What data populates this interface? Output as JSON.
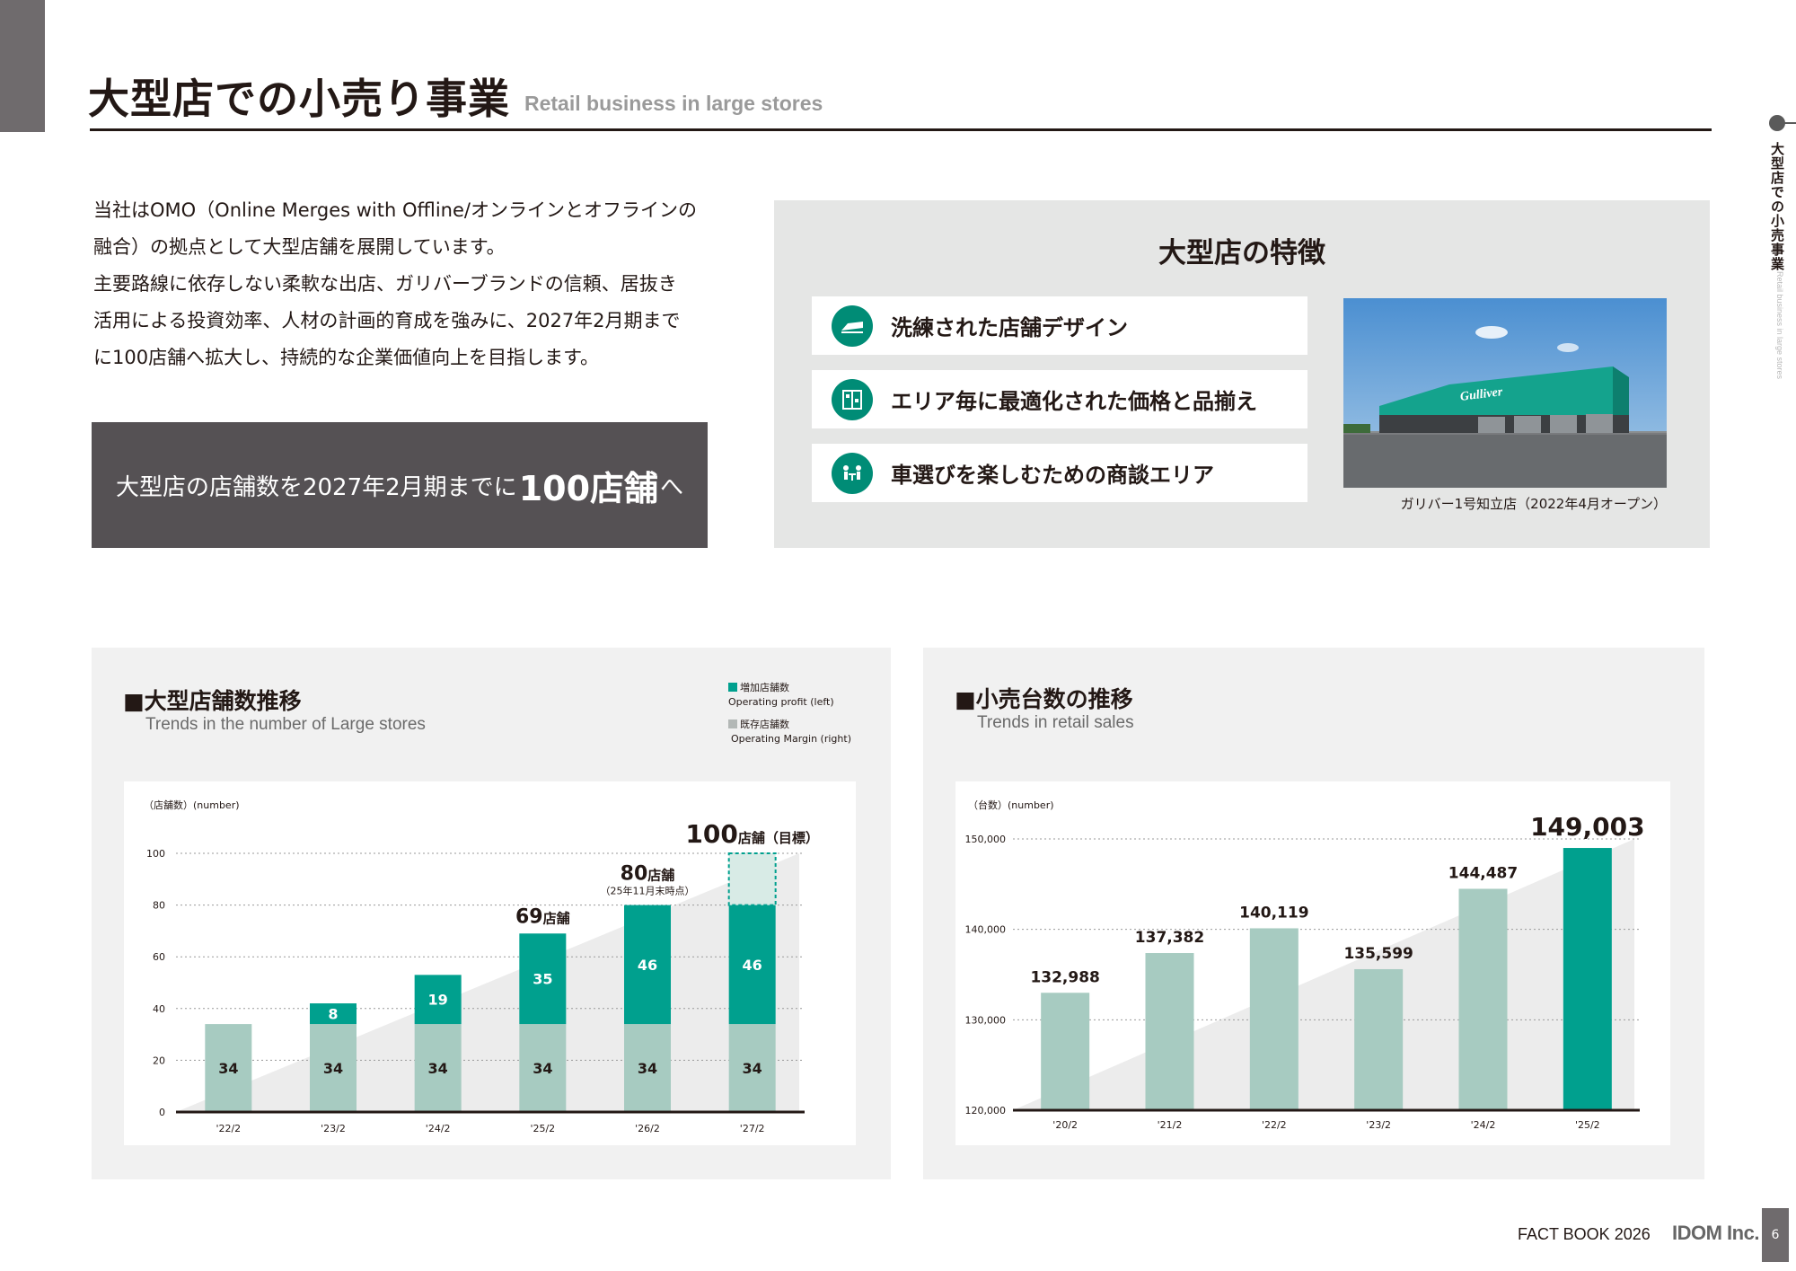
{
  "header": {
    "title_jp": "大型店での小売り事業",
    "title_en": "Retail business in large stores"
  },
  "side_label": {
    "jp": "大型店での小売事業",
    "en": "Retail business in large stores"
  },
  "intro": {
    "lines": [
      "当社はOMO（Online Merges with Offline/オンラインとオフラインの",
      "融合）の拠点として大型店舗を展開しています。",
      "主要路線に依存しない柔軟な出店、ガリバーブランドの信頼、居抜き",
      "活用による投資効率、人材の計画的育成を強みに、2027年2月期まで",
      "に100店舗へ拡大し、持続的な企業価値向上を目指します。"
    ]
  },
  "goal": {
    "prefix": "大型店の店舗数を2027年2月期までに",
    "highlight": "100店舗",
    "suffix": "へ"
  },
  "features": {
    "title": "大型店の特徴",
    "items": [
      {
        "label": "洗練された店舗デザイン",
        "icon": "store-design-icon"
      },
      {
        "label": "エリア毎に最適化された価格と品揃え",
        "icon": "price-lineup-icon"
      },
      {
        "label": "車選びを楽しむための商談エリア",
        "icon": "consultation-area-icon"
      }
    ],
    "photo_sign": "Gulliver",
    "photo_caption": "ガリバー1号知立店（2022年4月オープン）"
  },
  "colors": {
    "teal": "#00a08e",
    "light_teal": "#a7cbc1",
    "dark_panel": "#555154",
    "feature_icon": "#008c76"
  },
  "chart_data": [
    {
      "type": "bar",
      "stacked": true,
      "title": "■大型店舗数推移",
      "subtitle": "Trends in the number of Large stores",
      "unit_label": "（店舗数）(number)",
      "legend": [
        {
          "jp": "増加店舗数",
          "en": "Operating profit (left)",
          "color": "#00a08e"
        },
        {
          "jp": "既存店舗数",
          "en": "Operating Margin (right)",
          "color": "#b3b8b6"
        }
      ],
      "categories": [
        "'22/2",
        "'23/2",
        "'24/2",
        "'25/2",
        "'26/2",
        "'27/2"
      ],
      "series": [
        {
          "name": "既存店舗数",
          "values": [
            34,
            34,
            34,
            34,
            34,
            34
          ]
        },
        {
          "name": "増加店舗数",
          "values": [
            0,
            8,
            19,
            35,
            46,
            46
          ]
        }
      ],
      "target": {
        "category": "'27/2",
        "total": 100
      },
      "ylim": [
        0,
        100
      ],
      "yticks": [
        0,
        20,
        40,
        60,
        80,
        100
      ],
      "annotations": [
        {
          "category": "'25/2",
          "num": "69",
          "unit": "店舗",
          "note": ""
        },
        {
          "category": "'26/2",
          "num": "80",
          "unit": "店舗",
          "note": "（25年11月末時点）"
        },
        {
          "category": "'27/2",
          "num": "100",
          "unit": "店舗（目標）",
          "note": ""
        }
      ],
      "grid": true
    },
    {
      "type": "bar",
      "title": "■小売台数の推移",
      "subtitle": "Trends in retail sales",
      "unit_label": "（台数）(number)",
      "categories": [
        "'20/2",
        "'21/2",
        "'22/2",
        "'23/2",
        "'24/2",
        "'25/2"
      ],
      "values": [
        132988,
        137382,
        140119,
        135599,
        144487,
        149003
      ],
      "value_labels": [
        "132,988",
        "137,382",
        "140,119",
        "135,599",
        "144,487",
        "149,003"
      ],
      "ylim": [
        120000,
        150000
      ],
      "yticks": [
        120000,
        130000,
        140000,
        150000
      ],
      "ytick_labels": [
        "120,000",
        "130,000",
        "140,000",
        "150,000"
      ],
      "highlight_index": 5,
      "grid": true
    }
  ],
  "footer": {
    "factbook": "FACT BOOK 2026",
    "company": "IDOM Inc.",
    "page": "6"
  }
}
